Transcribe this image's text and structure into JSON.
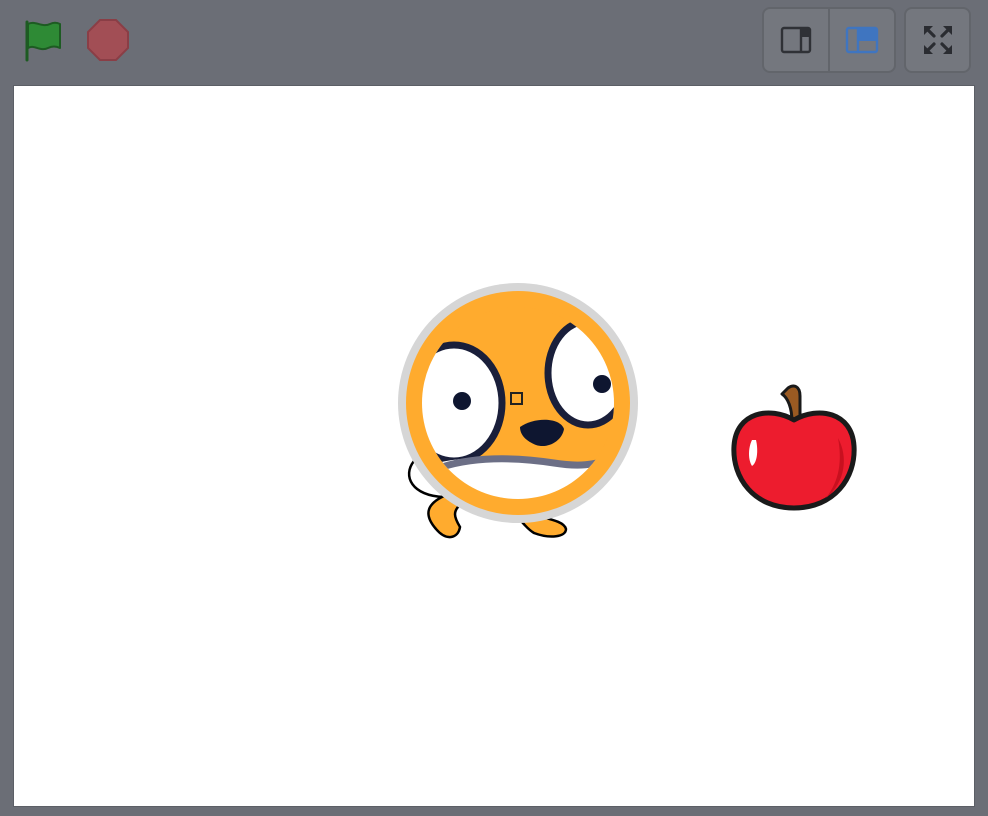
{
  "controls": {
    "green_flag": {
      "icon": "green-flag-icon",
      "color": "#2e8a35"
    },
    "stop": {
      "icon": "stop-sign-icon",
      "color": "#a24e55"
    },
    "stage_modes": [
      {
        "icon": "small-stage-icon",
        "active": false
      },
      {
        "icon": "large-stage-icon",
        "active": true,
        "accent": "#3f75c0"
      }
    ],
    "fullscreen": {
      "icon": "fullscreen-icon"
    }
  },
  "stage": {
    "background": "#ffffff",
    "sprites": [
      {
        "name": "cat",
        "icon": "cat-sprite-magnified-icon",
        "color": "#ffab2e"
      },
      {
        "name": "apple",
        "icon": "apple-icon",
        "color": "#ed1c2e"
      }
    ]
  }
}
